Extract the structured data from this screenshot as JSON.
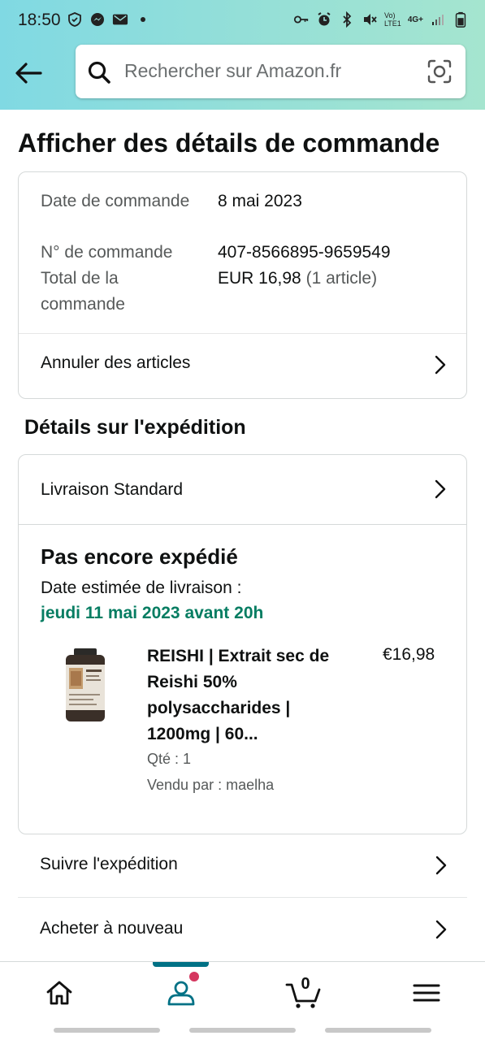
{
  "status_bar": {
    "time": "18:50",
    "network_label_top": "Vo)",
    "network_label_bottom": "LTE1",
    "network_type": "4G+"
  },
  "header": {
    "search_placeholder": "Rechercher sur Amazon.fr",
    "icons": [
      "back-arrow-icon",
      "search-icon",
      "camera-lens-icon"
    ]
  },
  "page": {
    "title": "Afficher des détails de commande"
  },
  "order_summary": {
    "date_label": "Date de commande",
    "date_value": "8 mai 2023",
    "number_label": "N° de commande",
    "number_value": "407-8566895-9659549",
    "total_label": "Total de la commande",
    "total_value": "EUR 16,98",
    "total_items": "(1 article)",
    "cancel_label": "Annuler des articles"
  },
  "shipping": {
    "section_title": "Détails sur l'expédition",
    "method": "Livraison Standard",
    "status": "Pas encore expédié",
    "estimate_label": "Date estimée de livraison :",
    "estimate_date": "jeudi 11 mai 2023 avant 20h",
    "product": {
      "title": "REISHI | Extrait sec de Reishi 50% polysaccharides | 1200mg | 60...",
      "price": "€16,98",
      "qty": "Qté : 1",
      "seller": "Vendu par : maelha"
    }
  },
  "actions": {
    "track": "Suivre l'expédition",
    "buy_again": "Acheter à nouveau"
  },
  "bottom_nav": {
    "items": [
      "home-icon",
      "account-icon",
      "cart-icon",
      "menu-icon"
    ],
    "cart_count": "0",
    "active_index": 1
  },
  "colors": {
    "header_gradient_start": "#80d9e3",
    "header_gradient_end": "#a5e5cf",
    "delivery_green": "#067d62",
    "accent_teal": "#007185",
    "badge_red": "#d5365f"
  }
}
